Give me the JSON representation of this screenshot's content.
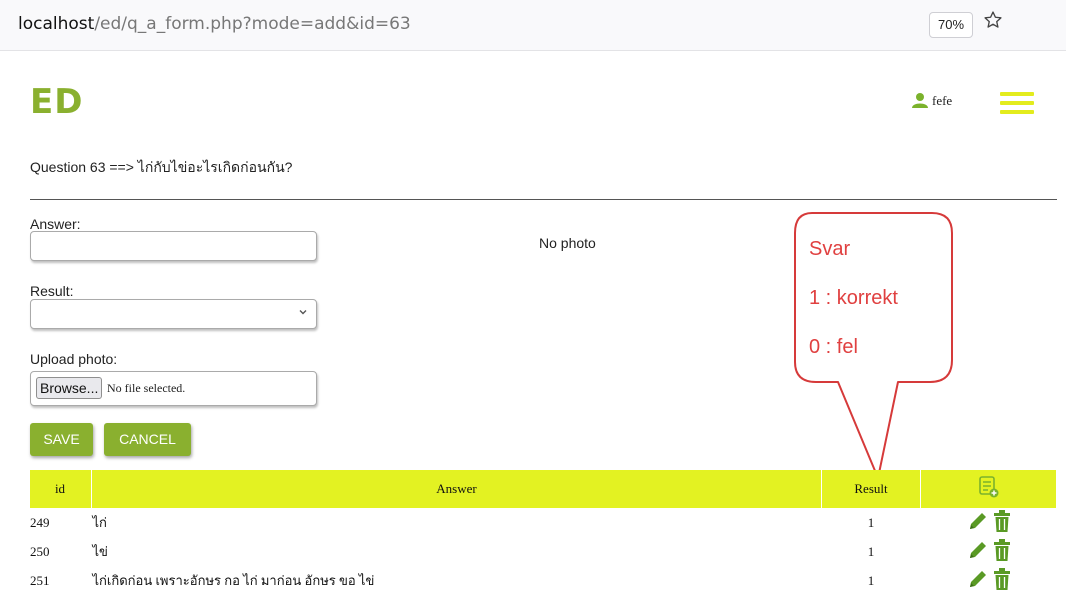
{
  "browser": {
    "url_host": "localhost",
    "url_path": "/ed/q_a_form.php?mode=add&id=63",
    "zoom": "70%",
    "star_icon": "bookmark-star-icon"
  },
  "header": {
    "logo": "ED",
    "username": "fefe",
    "user_icon": "user-icon",
    "menu_icon": "hamburger-menu-icon"
  },
  "question": {
    "text": "Question 63 ==> ไก่กับไข่อะไรเกิดก่อนกัน?"
  },
  "form": {
    "answer_label": "Answer:",
    "answer_value": "",
    "result_label": "Result:",
    "result_value": "",
    "upload_label": "Upload photo:",
    "browse_label": "Browse...",
    "no_file_text": "No file selected.",
    "no_photo_text": "No photo",
    "save_label": "SAVE",
    "cancel_label": "CANCEL"
  },
  "callout": {
    "lines": [
      "Svar",
      "1 : korrekt",
      "0 : fel"
    ],
    "color": "#e04040"
  },
  "table": {
    "header_color": "#e3f222",
    "columns": {
      "id": "id",
      "answer": "Answer",
      "result": "Result"
    },
    "header_action_icon": "add-row-icon",
    "rows": [
      {
        "id": "249",
        "answer": "ไก่",
        "result": "1"
      },
      {
        "id": "250",
        "answer": "ไข่",
        "result": "1"
      },
      {
        "id": "251",
        "answer": "ไก่เกิดก่อน เพราะอักษร กอ ไก่ มาก่อน อักษร ขอ ไข่",
        "result": "1"
      }
    ],
    "row_action_icons": [
      "edit-pencil-icon",
      "delete-trash-icon"
    ]
  },
  "colors": {
    "accent": "#8ab02f",
    "menu": "#e3ec1d",
    "icon_green": "#5a9a25"
  }
}
